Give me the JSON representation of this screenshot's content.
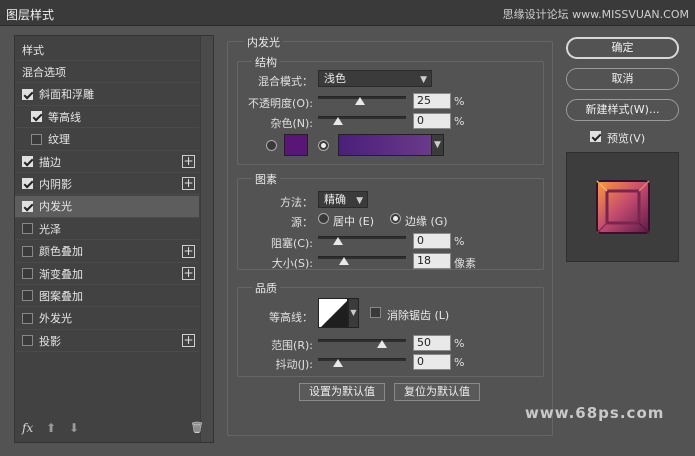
{
  "window": {
    "title": "图层样式",
    "watermark": "思缘设计论坛 www.MISSVUAN.COM"
  },
  "sidebar": {
    "items": [
      {
        "label": "样式",
        "checkbox": null,
        "plus": false,
        "active": false
      },
      {
        "label": "混合选项",
        "checkbox": null,
        "plus": false,
        "active": false
      },
      {
        "label": "斜面和浮雕",
        "checkbox": true,
        "plus": false,
        "active": false
      },
      {
        "label": "等高线",
        "checkbox": true,
        "plus": false,
        "active": false,
        "indent": true
      },
      {
        "label": "纹理",
        "checkbox": false,
        "plus": false,
        "active": false,
        "indent": true
      },
      {
        "label": "描边",
        "checkbox": true,
        "plus": true,
        "active": false
      },
      {
        "label": "内阴影",
        "checkbox": true,
        "plus": true,
        "active": false
      },
      {
        "label": "内发光",
        "checkbox": true,
        "plus": false,
        "active": true
      },
      {
        "label": "光泽",
        "checkbox": false,
        "plus": false,
        "active": false
      },
      {
        "label": "颜色叠加",
        "checkbox": false,
        "plus": true,
        "active": false
      },
      {
        "label": "渐变叠加",
        "checkbox": false,
        "plus": true,
        "active": false
      },
      {
        "label": "图案叠加",
        "checkbox": false,
        "plus": false,
        "active": false
      },
      {
        "label": "外发光",
        "checkbox": false,
        "plus": false,
        "active": false
      },
      {
        "label": "投影",
        "checkbox": false,
        "plus": true,
        "active": false
      }
    ],
    "footer": {
      "fx": "fx",
      "up": "⬆",
      "down": "⬇",
      "trash": "🗑"
    }
  },
  "panel": {
    "title": "内发光",
    "structure": {
      "legend": "结构",
      "blend_mode_label": "混合模式：",
      "blend_mode_value": "浅色",
      "opacity_label": "不透明度(O):",
      "opacity_value": "25",
      "opacity_unit": "%",
      "opacity_level": 0.25,
      "noise_label": "杂色(N):",
      "noise_value": "0",
      "noise_unit": "%",
      "noise_level": 0.0,
      "color_swatch": "#5a1676",
      "gradient_start": "#4a1f7a",
      "gradient_end": "#6a3a8a"
    },
    "elements": {
      "legend": "图素",
      "method_label": "方法：",
      "method_value": "精确",
      "source_label": "源：",
      "source_center": "居中 (E)",
      "source_edge": "边缘 (G)",
      "choke_label": "阻塞(C):",
      "choke_value": "0",
      "choke_unit": "%",
      "choke_level": 0.0,
      "size_label": "大小(S):",
      "size_value": "18",
      "size_unit": "像素",
      "size_level": 0.07
    },
    "quality": {
      "legend": "品质",
      "contour_label": "等高线：",
      "antialias_label": "消除锯齿 (L)",
      "range_label": "范围(R):",
      "range_value": "50",
      "range_unit": "%",
      "range_level": 0.5,
      "jitter_label": "抖动(J):",
      "jitter_value": "0",
      "jitter_unit": "%",
      "jitter_level": 0.0
    },
    "make_default": "设置为默认值",
    "reset_default": "复位为默认值"
  },
  "buttons": {
    "ok": "确定",
    "cancel": "取消",
    "new_style": "新建样式(W)...",
    "preview_label": "预览(V)"
  },
  "site_mark": "www.68ps.com"
}
